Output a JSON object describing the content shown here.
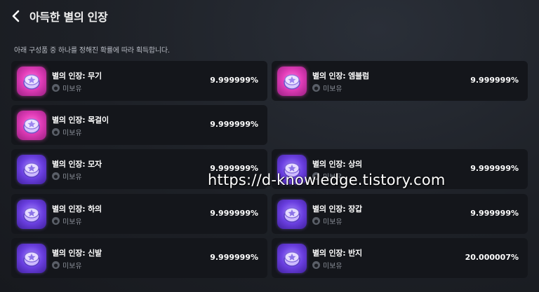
{
  "header": {
    "title": "아득한 별의 인장"
  },
  "description": "아래 구성품 중 하나를 정해진 확률에 따라 획득합니다.",
  "items": [
    {
      "name": "별의 인장: 무기",
      "status": "미보유",
      "percent": "9.999999%",
      "icon_color": "#e13cb8"
    },
    {
      "name": "별의 인장: 엠블럼",
      "status": "미보유",
      "percent": "9.999999%",
      "icon_color": "#e13cb8"
    },
    {
      "name": "별의 인장: 목걸이",
      "status": "미보유",
      "percent": "9.999999%",
      "icon_color": "#e13cb8"
    },
    {
      "name": "별의 인장: 모자",
      "status": "미보유",
      "percent": "9.999999%",
      "icon_color": "#6a3fe0"
    },
    {
      "name": "별의 인장: 상의",
      "status": "미보유",
      "percent": "9.999999%",
      "icon_color": "#6a3fe0"
    },
    {
      "name": "별의 인장: 하의",
      "status": "미보유",
      "percent": "9.999999%",
      "icon_color": "#6a3fe0"
    },
    {
      "name": "별의 인장: 장갑",
      "status": "미보유",
      "percent": "9.999999%",
      "icon_color": "#6a3fe0"
    },
    {
      "name": "별의 인장: 신발",
      "status": "미보유",
      "percent": "9.999999%",
      "icon_color": "#6a3fe0"
    },
    {
      "name": "별의 인장: 반지",
      "status": "미보유",
      "percent": "20.000007%",
      "icon_color": "#6a3fe0"
    }
  ],
  "watermark": "https://d-knowledge.tistory.com",
  "icons": {
    "back": "chevron-left-icon",
    "item": "star-seal-icon",
    "status": "lock-badge-icon"
  },
  "colors": {
    "background": "#1d2026",
    "card": "#14161b",
    "pink_seal": "#e13cb8",
    "purple_seal": "#6a3fe0"
  }
}
